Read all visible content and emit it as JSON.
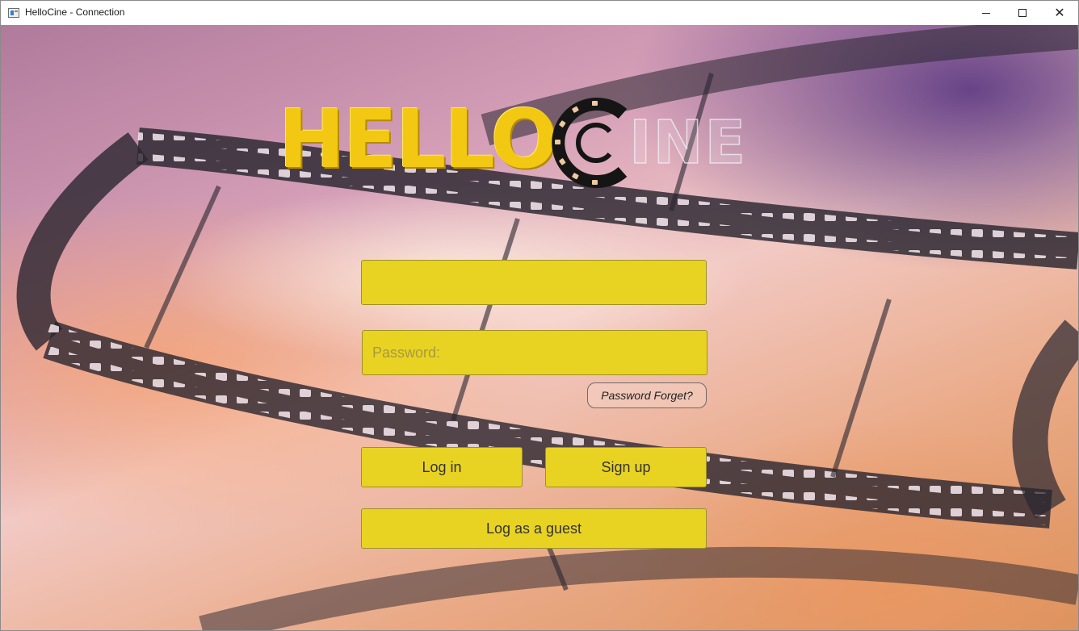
{
  "window": {
    "title": "HelloCine - Connection",
    "minimize_icon": "minimize-icon",
    "maximize_icon": "maximize-icon",
    "close_icon": "close-icon",
    "close_glyph": "✕"
  },
  "logo": {
    "hello_text": "HELLO",
    "cine_text": "INE",
    "reel_icon": "film-reel-icon",
    "hello_color": "#f3c812"
  },
  "form": {
    "username": {
      "value": "",
      "placeholder": ""
    },
    "password": {
      "value": "",
      "placeholder": "Password:"
    },
    "forget_label": "Password Forget?",
    "login_label": "Log in",
    "signup_label": "Sign up",
    "guest_label": "Log as a guest"
  },
  "colors": {
    "button_fill": "#e9d322",
    "button_border": "#9e9128"
  }
}
